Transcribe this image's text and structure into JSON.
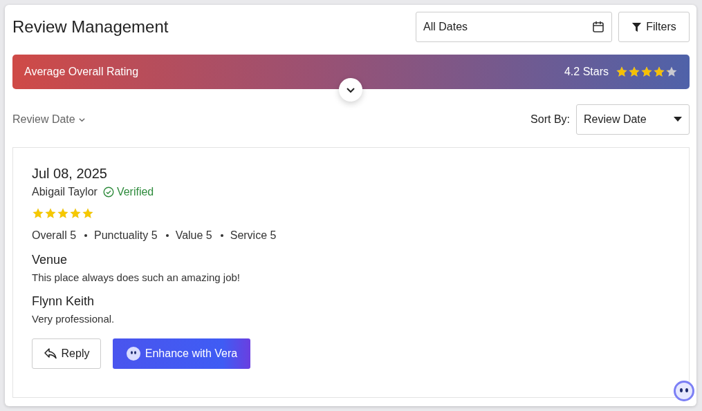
{
  "header": {
    "title": "Review Management",
    "date_filter": {
      "value": "All Dates"
    },
    "filters_button": "Filters"
  },
  "rating_banner": {
    "label": "Average Overall Rating",
    "reading": "4.2 Stars",
    "stars": 4.2
  },
  "toolbar": {
    "group_label": "Review Date",
    "sort_label": "Sort By:",
    "sort_value": "Review Date"
  },
  "reviews": [
    {
      "date": "Jul 08, 2025",
      "author": "Abigail Taylor",
      "verified": true,
      "verified_label": "Verified",
      "stars": 5,
      "scores": [
        "Overall 5",
        "Punctuality 5",
        "Value 5",
        "Service 5"
      ],
      "sections": [
        {
          "title": "Venue",
          "text": "This place always does such an amazing job!"
        },
        {
          "title": "Flynn Keith",
          "text": "Very professional."
        }
      ],
      "reply_button": "Reply",
      "enhance_button": "Enhance with Vera"
    }
  ]
}
